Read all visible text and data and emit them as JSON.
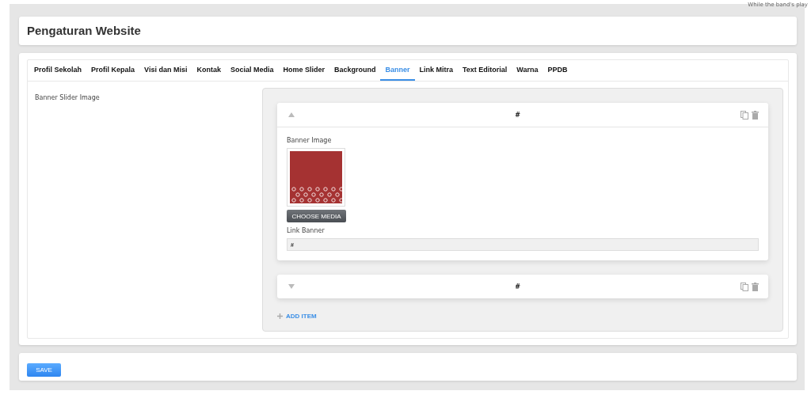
{
  "corner_text": "While the band's play",
  "page_title": "Pengaturan Website",
  "tabs": [
    {
      "label": "Profil Sekolah",
      "selected": false
    },
    {
      "label": "Profil Kepala",
      "selected": false
    },
    {
      "label": "Visi dan Misi",
      "selected": false
    },
    {
      "label": "Kontak",
      "selected": false
    },
    {
      "label": "Social Media",
      "selected": false
    },
    {
      "label": "Home Slider",
      "selected": false
    },
    {
      "label": "Background",
      "selected": false
    },
    {
      "label": "Banner",
      "selected": true
    },
    {
      "label": "Link Mitra",
      "selected": false
    },
    {
      "label": "Text Editorial",
      "selected": false
    },
    {
      "label": "Warna",
      "selected": false
    },
    {
      "label": "PPDB",
      "selected": false
    }
  ],
  "section_label": "Banner Slider Image",
  "items": [
    {
      "title": "#",
      "expanded": true,
      "image_label": "Banner Image",
      "choose_button": "CHOOSE MEDIA",
      "link_label": "Link Banner",
      "link_value": "#"
    },
    {
      "title": "#",
      "expanded": false
    }
  ],
  "add_item": "ADD ITEM",
  "save_button": "SAVE"
}
